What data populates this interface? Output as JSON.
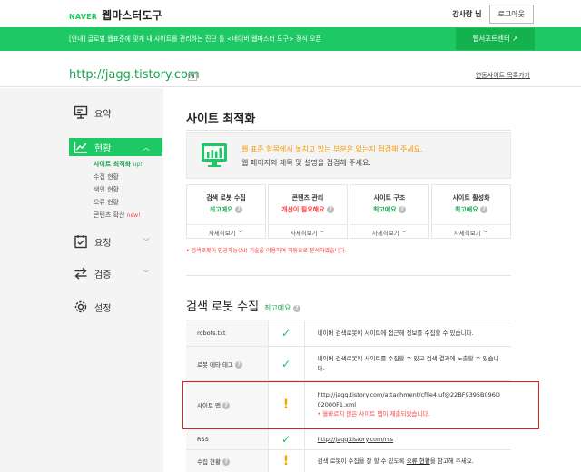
{
  "header": {
    "brand": "NAVER",
    "title": "웹마스터도구",
    "user": "강사랑 님",
    "logout_label": "로그아웃"
  },
  "banner": {
    "notice": "[안내] 글로벌 웹표준에 맞게 내 사이트를 관리하는 진단 툴 <네이버 웹마스터 도구> 정식 오픈",
    "support_label": "웹서포트센터 ↗"
  },
  "site": {
    "url": "http://jagg.tistory.com",
    "connected_label": "연동사이트 목록가기"
  },
  "sidebar": {
    "items": [
      {
        "label": "요약",
        "icon": "monitor-icon"
      },
      {
        "label": "현황",
        "icon": "chart-icon"
      },
      {
        "label": "요청",
        "icon": "checklist-icon"
      },
      {
        "label": "검증",
        "icon": "arrows-icon"
      },
      {
        "label": "설정",
        "icon": "gear-icon"
      }
    ],
    "subitems": [
      {
        "label": "사이트 최적화",
        "badge": "up!"
      },
      {
        "label": "수집 현황"
      },
      {
        "label": "색인 현황"
      },
      {
        "label": "오류 현황"
      },
      {
        "label": "콘텐츠 확산",
        "badge": "new!"
      }
    ]
  },
  "main": {
    "title": "사이트 최적화",
    "summary": {
      "line1": "웹 표준 항목에서 놓치고 있는 부분은 없는지 점검해 주세요.",
      "line2": "웹 페이지의 제목 및 설명을 점검해 주세요."
    },
    "cards": [
      {
        "title": "검색 로봇 수집",
        "status": "최고에요",
        "more": "자세히보기 ﹀"
      },
      {
        "title": "콘텐츠 관리",
        "status": "개선이 필요해요",
        "more": "자세히보기 ﹀"
      },
      {
        "title": "사이트 구조",
        "status": "최고에요",
        "more": "자세히보기 ﹀"
      },
      {
        "title": "사이트 활성화",
        "status": "최고에요",
        "more": "자세히보기 ﹀"
      }
    ],
    "footnote": "• 검색로봇이 인공지능(AI) 기술을 이용하여 자동으로 분석하였습니다.",
    "section": {
      "title": "검색 로봇 수집",
      "status": "최고에요"
    },
    "rows": [
      {
        "label": "robots.txt",
        "icon": "check-icon",
        "desc": "네이버 검색로봇이 사이트에 접근해 정보를 수집할 수 있습니다."
      },
      {
        "label": "로봇 메타 태그",
        "icon": "check-icon",
        "desc": "네이버 검색로봇이 사이트를 수집할 수 있고 검색 결과에 노출할 수 있습니다."
      },
      {
        "label": "사이트 맵",
        "icon": "exclamation-icon",
        "link": "http://jagg.tistory.com/attachment/cfile4.uf@22BF9395B096D02000F1.xml",
        "warning": "• 올바르지 않은 사이트 맵이 제출되었습니다."
      },
      {
        "label": "RSS",
        "icon": "check-icon",
        "link": "http://jagg.tistory.com/rss"
      },
      {
        "label": "수집 현황",
        "icon": "exclamation-icon",
        "desc_pre": "검색 로봇이 수집을 잘 할 수 있도록",
        "desc_link": "오류 현황",
        "desc_post": "을 참고해 주세요."
      }
    ]
  },
  "colors": {
    "accent": "#1ec864",
    "warning": "#f39800",
    "error": "#ff3b3b",
    "highlight_box": "#e0201f"
  }
}
